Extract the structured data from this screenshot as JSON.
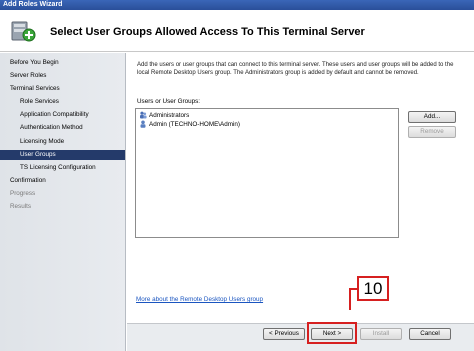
{
  "window": {
    "title": "Add Roles Wizard"
  },
  "header": {
    "title": "Select User Groups Allowed Access To This Terminal Server"
  },
  "sidebar": {
    "items": [
      {
        "label": "Before You Begin",
        "level": 0,
        "state": "normal"
      },
      {
        "label": "Server Roles",
        "level": 0,
        "state": "normal"
      },
      {
        "label": "Terminal Services",
        "level": 0,
        "state": "normal"
      },
      {
        "label": "Role Services",
        "level": 1,
        "state": "normal"
      },
      {
        "label": "Application Compatibility",
        "level": 1,
        "state": "normal"
      },
      {
        "label": "Authentication Method",
        "level": 1,
        "state": "normal"
      },
      {
        "label": "Licensing Mode",
        "level": 1,
        "state": "normal"
      },
      {
        "label": "User Groups",
        "level": 1,
        "state": "active"
      },
      {
        "label": "TS Licensing Configuration",
        "level": 1,
        "state": "normal"
      },
      {
        "label": "Confirmation",
        "level": 0,
        "state": "normal"
      },
      {
        "label": "Progress",
        "level": 0,
        "state": "disabled"
      },
      {
        "label": "Results",
        "level": 0,
        "state": "disabled"
      }
    ]
  },
  "main": {
    "description": "Add the users or user groups that can connect to this terminal server. These users and user groups will be added to the local Remote Desktop Users group. The Administrators group is added by default and cannot be removed.",
    "list_label": "Users or User Groups:",
    "list_items": [
      "Administrators",
      "Admin (TECHNO-HOME\\Admin)"
    ],
    "add_button": "Add...",
    "remove_button": "Remove",
    "link": "More about the Remote Desktop Users group"
  },
  "footer": {
    "previous_button": "< Previous",
    "next_button": "Next >",
    "install_button": "Install",
    "cancel_button": "Cancel"
  },
  "annotation": {
    "step_number": "10",
    "color": "#d62020"
  }
}
